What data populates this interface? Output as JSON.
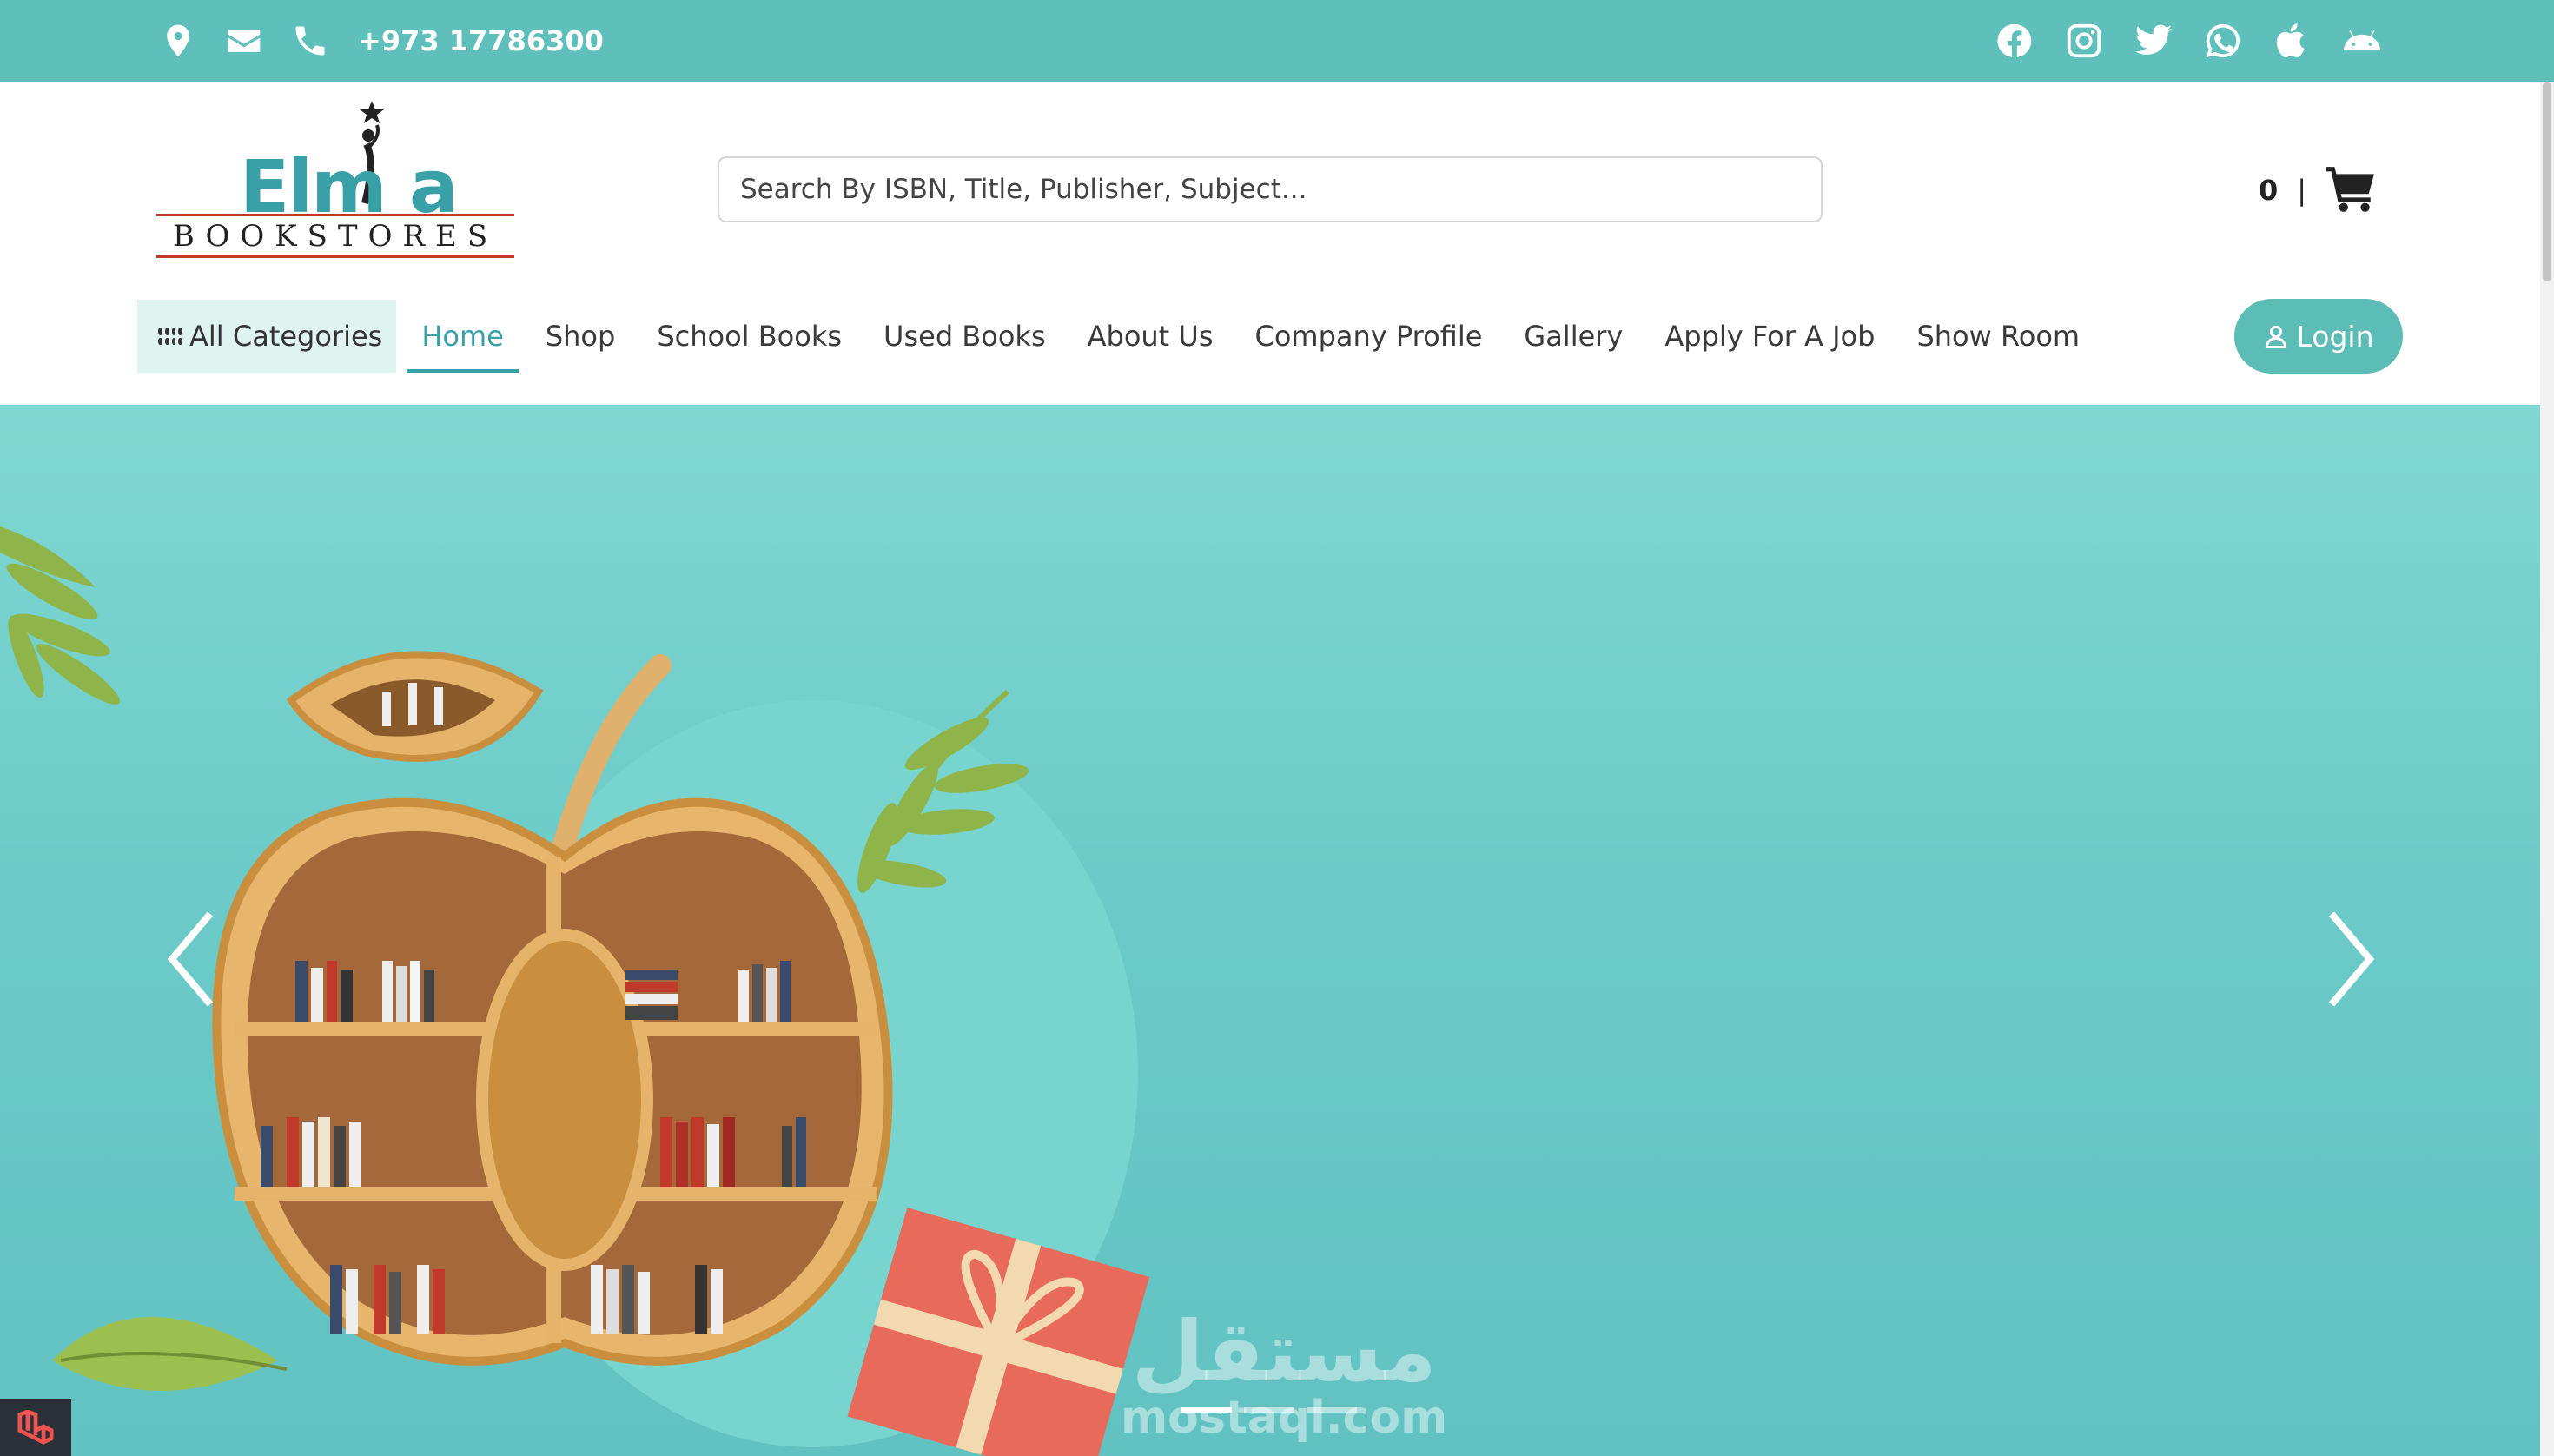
{
  "topbar": {
    "phone": "+973 17786300",
    "left_icons": [
      "location-pin-icon",
      "envelope-icon",
      "phone-icon"
    ],
    "social_icons": [
      "facebook-icon",
      "instagram-icon",
      "twitter-icon",
      "whatsapp-icon",
      "apple-icon",
      "android-icon"
    ],
    "bg_color": "#5fbfbb"
  },
  "logo": {
    "title": "Elm a",
    "subtitle": "BOOKSTORES"
  },
  "search": {
    "placeholder": "Search By ISBN, Title, Publisher, Subject..."
  },
  "cart": {
    "count": "0",
    "separator": "|"
  },
  "nav": {
    "all_categories": "All Categories",
    "items": [
      {
        "label": "Home",
        "active": true
      },
      {
        "label": "Shop"
      },
      {
        "label": "School Books"
      },
      {
        "label": "Used Books"
      },
      {
        "label": "About Us"
      },
      {
        "label": "Company Profile"
      },
      {
        "label": "Gallery"
      },
      {
        "label": "Apply For A Job"
      },
      {
        "label": "Show Room"
      }
    ],
    "login": "Login",
    "accent_color": "#3aa0a8"
  },
  "hero": {
    "slides": 3,
    "active_slide": 1,
    "watermark_ar": "مستقل",
    "watermark_en": "mostaql.com",
    "bg_color": "#6ccbc8"
  }
}
